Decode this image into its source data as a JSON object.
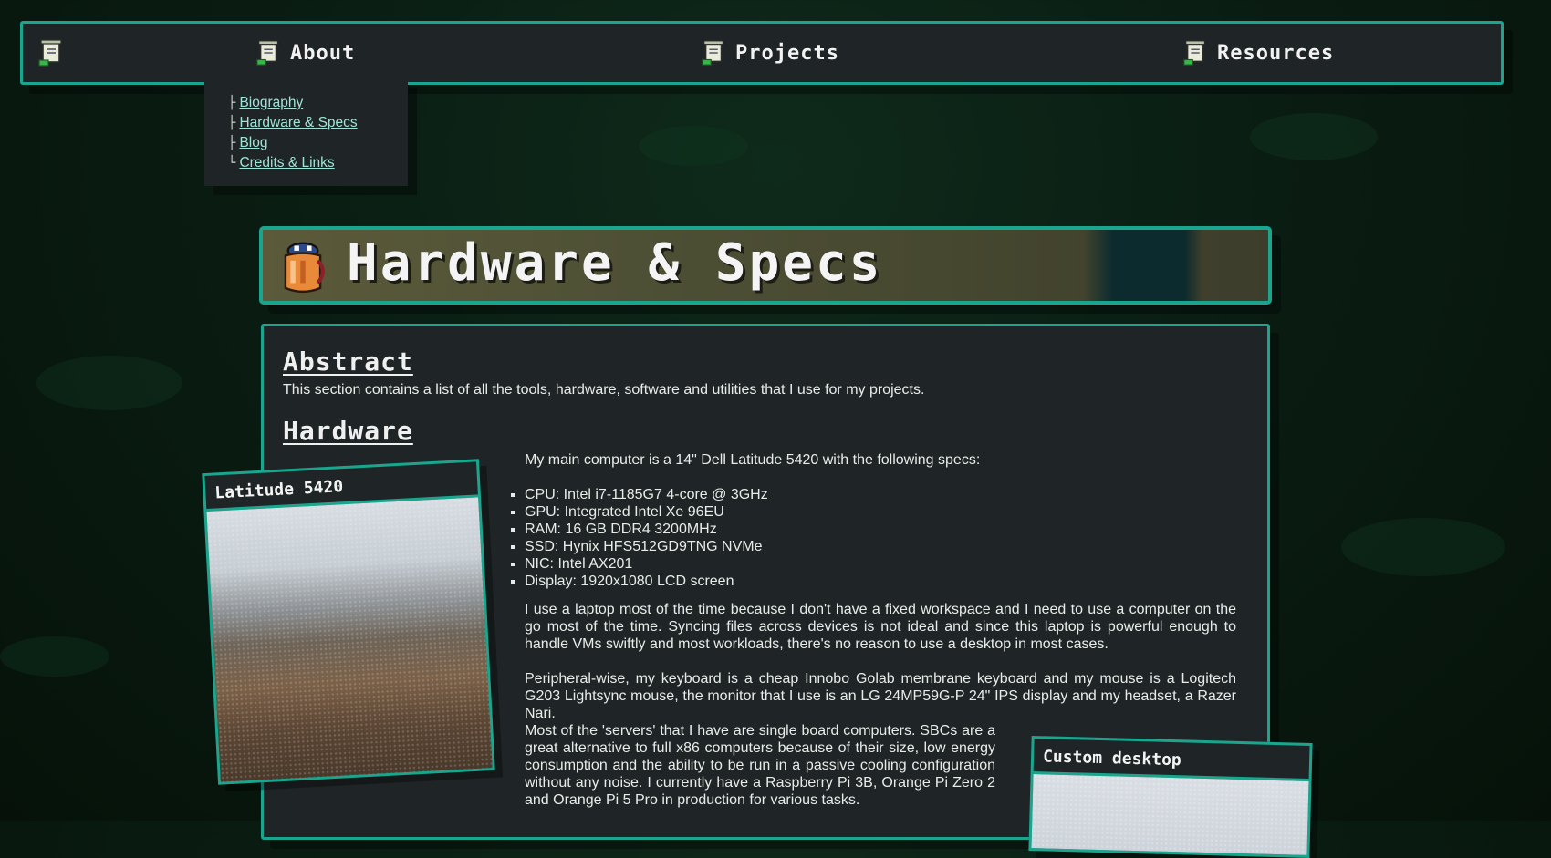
{
  "nav": {
    "home_icon": "scroll-icon",
    "items": [
      {
        "label": "About",
        "icon": "scroll-icon"
      },
      {
        "label": "Projects",
        "icon": "scroll-icon"
      },
      {
        "label": "Resources",
        "icon": "scroll-icon"
      }
    ],
    "dropdown": [
      {
        "prefix": "├",
        "label": "Biography"
      },
      {
        "prefix": "├",
        "label": "Hardware & Specs"
      },
      {
        "prefix": "├",
        "label": "Blog"
      },
      {
        "prefix": "└",
        "label": "Credits & Links"
      }
    ]
  },
  "banner": {
    "title": "Hardware & Specs",
    "icon": "jar-icon"
  },
  "content": {
    "abstract_heading": "Abstract",
    "abstract_text": "This section contains a list of all the tools, hardware, software and utilities that I use for my projects.",
    "hardware_heading": "Hardware",
    "intro": "My main computer is a 14\" Dell Latitude 5420 with the following specs:",
    "specs": [
      "CPU: Intel i7-1185G7 4-core @ 3GHz",
      "GPU: Integrated Intel Xe 96EU",
      "RAM: 16 GB DDR4 3200MHz",
      "SSD: Hynix HFS512GD9TNG NVMe",
      "NIC: Intel AX201",
      "Display: 1920x1080 LCD screen"
    ],
    "para1": "I use a laptop most of the time because I don't have a fixed workspace and I need to use a computer on the go most of the time. Syncing files across devices is not ideal and since this laptop is powerful enough to handle VMs swiftly and most workloads, there's no reason to use a desktop in most cases.",
    "para2": "Peripheral-wise, my keyboard is a cheap Innobo Golab membrane keyboard and my mouse is a Logitech G203 Lightsync mouse, the monitor that I use is an LG 24MP59G-P 24\" IPS display and my headset, a Razer Nari.",
    "para3": "Most of the 'servers' that I have are single board computers. SBCs are a great alternative to full x86 computers because of their size, low energy consumption and the ability to be run in a passive cooling configuration without any noise. I currently have a Raspberry Pi 3B, Orange Pi Zero 2 and Orange Pi 5 Pro in production for various tasks.",
    "card1_caption": "Latitude 5420",
    "card2_caption": "Custom desktop"
  },
  "colors": {
    "accent": "#1aa68e",
    "panel": "#1f2526",
    "link": "#9fe3d8"
  }
}
